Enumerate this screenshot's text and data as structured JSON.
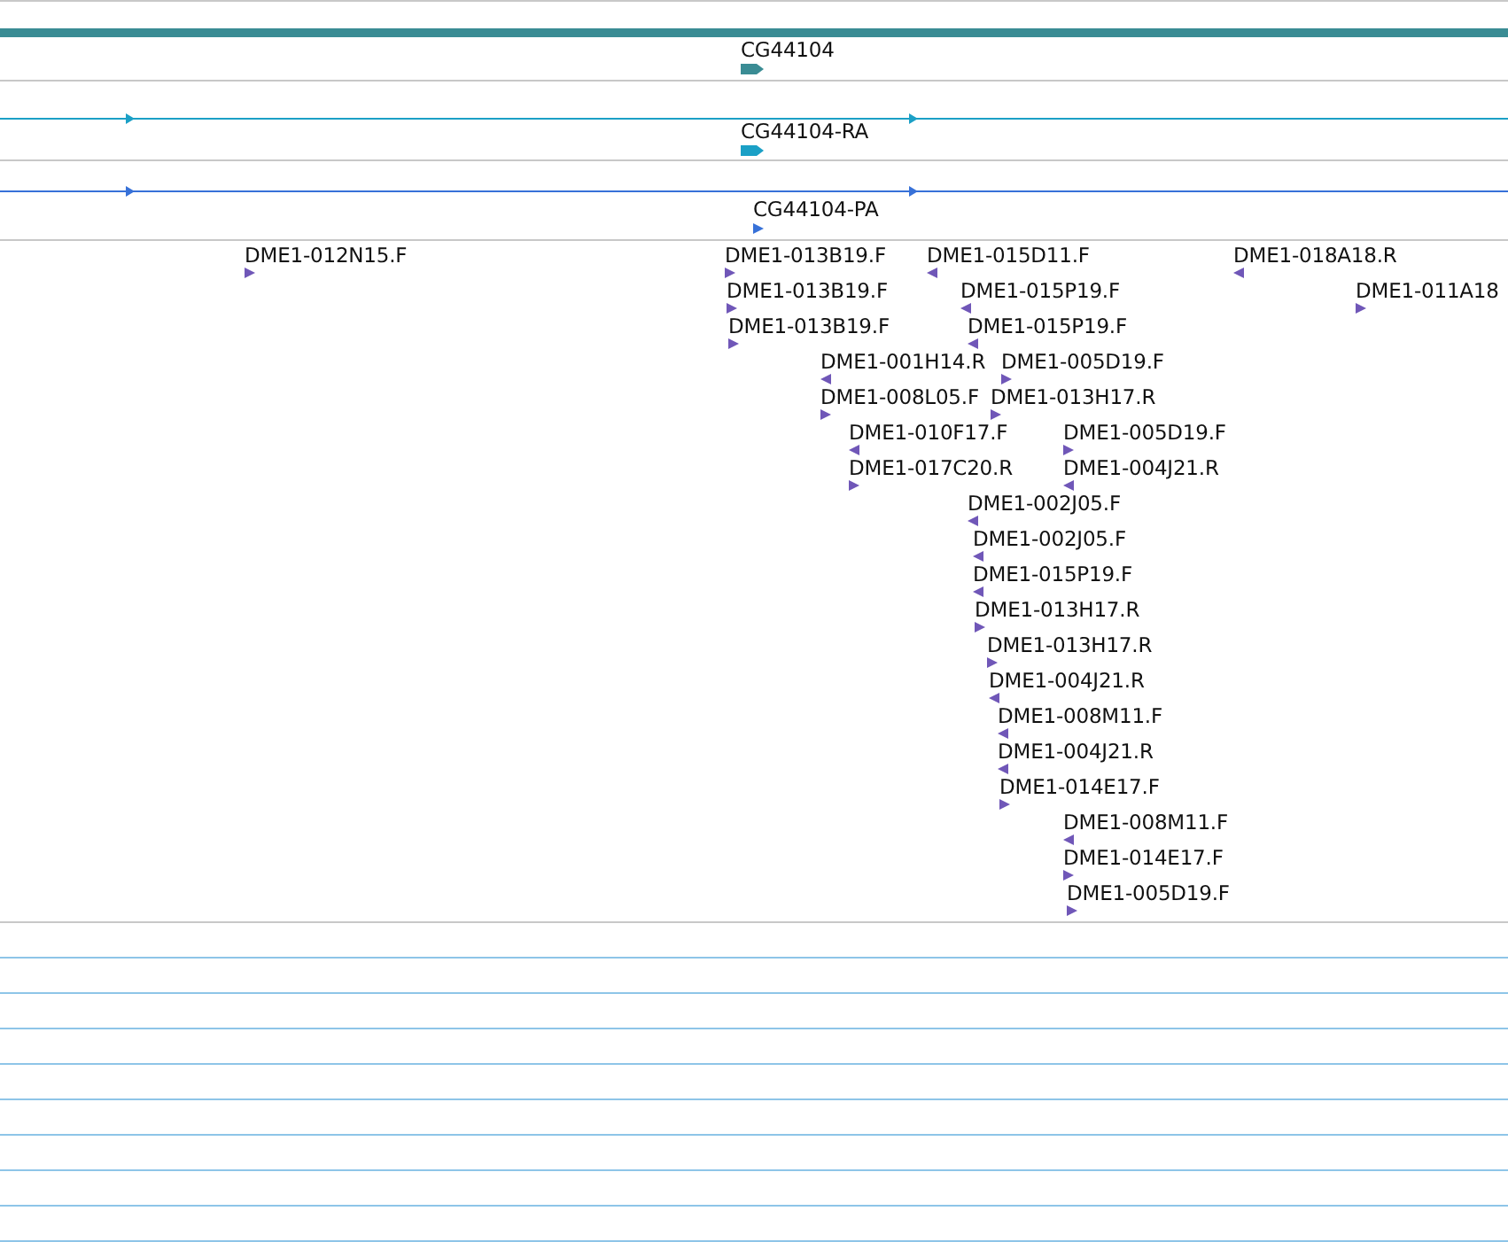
{
  "tracks": [
    {
      "kind": "gene",
      "features": [
        {
          "label": "CG44104",
          "reverse": false
        }
      ]
    },
    {
      "kind": "transcript",
      "features": [
        {
          "label": "CG44104-RA",
          "reverse": false
        }
      ]
    },
    {
      "kind": "protein",
      "features": [
        {
          "label": "CG44104-PA",
          "reverse": false
        }
      ]
    },
    {
      "kind": "est",
      "features": [
        {
          "label": "DME1-012N15.F",
          "reverse": false
        },
        {
          "label": "DME1-013B19.F",
          "reverse": false
        },
        {
          "label": "DME1-015D11.F",
          "reverse": true
        },
        {
          "label": "DME1-018A18.R",
          "reverse": true
        },
        {
          "label": "DME1-013B19.F",
          "reverse": false
        },
        {
          "label": "DME1-015P19.F",
          "reverse": true
        },
        {
          "label": "DME1-011A18",
          "reverse": false
        },
        {
          "label": "DME1-013B19.F",
          "reverse": false
        },
        {
          "label": "DME1-015P19.F",
          "reverse": true
        },
        {
          "label": "DME1-001H14.R",
          "reverse": true
        },
        {
          "label": "DME1-005D19.F",
          "reverse": false
        },
        {
          "label": "DME1-008L05.F",
          "reverse": false
        },
        {
          "label": "DME1-013H17.R",
          "reverse": false
        },
        {
          "label": "DME1-010F17.F",
          "reverse": true
        },
        {
          "label": "DME1-005D19.F",
          "reverse": false
        },
        {
          "label": "DME1-017C20.R",
          "reverse": false
        },
        {
          "label": "DME1-004J21.R",
          "reverse": true
        },
        {
          "label": "DME1-002J05.F",
          "reverse": true
        },
        {
          "label": "DME1-002J05.F",
          "reverse": true
        },
        {
          "label": "DME1-015P19.F",
          "reverse": true
        },
        {
          "label": "DME1-013H17.R",
          "reverse": false
        },
        {
          "label": "DME1-013H17.R",
          "reverse": false
        },
        {
          "label": "DME1-004J21.R",
          "reverse": true
        },
        {
          "label": "DME1-008M11.F",
          "reverse": true
        },
        {
          "label": "DME1-004J21.R",
          "reverse": true
        },
        {
          "label": "DME1-014E17.F",
          "reverse": false
        },
        {
          "label": "DME1-008M11.F",
          "reverse": true
        },
        {
          "label": "DME1-014E17.F",
          "reverse": false
        },
        {
          "label": "DME1-005D19.F",
          "reverse": false
        }
      ]
    }
  ]
}
